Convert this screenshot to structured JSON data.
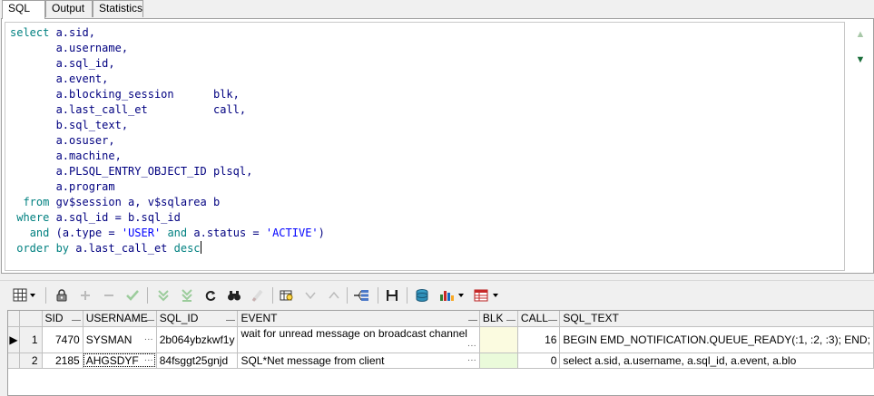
{
  "tabs": [
    {
      "label": "SQL",
      "active": true
    },
    {
      "label": "Output",
      "active": false
    },
    {
      "label": "Statistics",
      "active": false
    }
  ],
  "editor": {
    "lines": [
      [
        {
          "t": "select",
          "c": "kw"
        },
        {
          "t": " a.sid,"
        }
      ],
      [
        {
          "t": "       a.username,"
        }
      ],
      [
        {
          "t": "       a.sql_id,"
        }
      ],
      [
        {
          "t": "       a.event,"
        }
      ],
      [
        {
          "t": "       a.blocking_session      blk,"
        }
      ],
      [
        {
          "t": "       a.last_call_et          call,"
        }
      ],
      [
        {
          "t": "       b.sql_text,"
        }
      ],
      [
        {
          "t": "       a.osuser,"
        }
      ],
      [
        {
          "t": "       a.machine,"
        }
      ],
      [
        {
          "t": "       a.PLSQL_ENTRY_OBJECT_ID plsql,"
        }
      ],
      [
        {
          "t": "       a.program"
        }
      ],
      [
        {
          "t": "  "
        },
        {
          "t": "from",
          "c": "kw"
        },
        {
          "t": " gv$session a, v$sqlarea b"
        }
      ],
      [
        {
          "t": " "
        },
        {
          "t": "where",
          "c": "kw"
        },
        {
          "t": " a.sql_id = b.sql_id"
        }
      ],
      [
        {
          "t": "   "
        },
        {
          "t": "and",
          "c": "kw"
        },
        {
          "t": " (a.type = "
        },
        {
          "t": "'USER'",
          "c": "str"
        },
        {
          "t": " "
        },
        {
          "t": "and",
          "c": "kw"
        },
        {
          "t": " a.status = "
        },
        {
          "t": "'ACTIVE'",
          "c": "str"
        },
        {
          "t": ")"
        }
      ],
      [
        {
          "t": " "
        },
        {
          "t": "order by",
          "c": "kw"
        },
        {
          "t": " a.last_call_et "
        },
        {
          "t": "desc",
          "c": "kw"
        },
        {
          "t": "",
          "cursor": true
        }
      ]
    ]
  },
  "grid": {
    "columns": [
      "SID",
      "USERNAME",
      "SQL_ID",
      "EVENT",
      "BLK",
      "CALL",
      "SQL_TEXT"
    ],
    "rows": [
      {
        "rownum": "1",
        "current": true,
        "sid": "7470",
        "username": "SYSMAN",
        "sql_id": "2b064ybzkwf1y",
        "event": "wait for unread message on broadcast channel",
        "blk": "",
        "call": "16",
        "sql_text": "BEGIN EMD_NOTIFICATION.QUEUE_READY(:1, :2, :3); END;"
      },
      {
        "rownum": "2",
        "current": false,
        "sid": "2185",
        "username": "AHGSDYF",
        "sql_id": "84fsggt25gnjd",
        "event": "SQL*Net message from client",
        "blk": "",
        "call": "0",
        "sql_text": "select a.sid,        a.username,        a.sql_id,        a.event,        a.blo"
      }
    ]
  },
  "colors": {
    "keyword": "#008080",
    "identifier": "#000080",
    "string": "#0000ff",
    "row_highlight": "#e6f8e6"
  }
}
